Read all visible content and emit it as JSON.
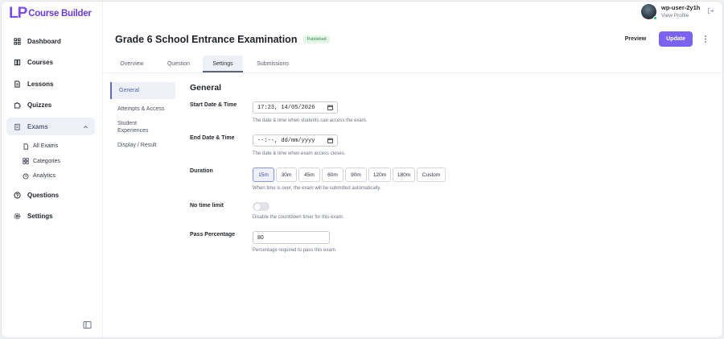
{
  "brand": {
    "mark": "LP",
    "name": "Course Builder"
  },
  "user": {
    "name": "wp-user-2y1h",
    "link": "View Profile"
  },
  "sidebar": {
    "items": [
      {
        "label": "Dashboard",
        "icon": "dashboard-icon"
      },
      {
        "label": "Courses",
        "icon": "book-icon"
      },
      {
        "label": "Lessons",
        "icon": "document-icon"
      },
      {
        "label": "Quizzes",
        "icon": "puzzle-icon"
      },
      {
        "label": "Exams",
        "icon": "clipboard-icon"
      },
      {
        "label": "Questions",
        "icon": "question-icon"
      },
      {
        "label": "Settings",
        "icon": "gear-icon"
      }
    ],
    "exams_sub": [
      {
        "label": "All Exams",
        "icon": "file-icon"
      },
      {
        "label": "Categories",
        "icon": "grid-icon"
      },
      {
        "label": "Analytics",
        "icon": "clock-icon"
      }
    ]
  },
  "header": {
    "title": "Grade 6 School Entrance Examination",
    "status": "Published",
    "preview_label": "Preview",
    "update_label": "Update"
  },
  "tabs": [
    "Overview",
    "Question",
    "Settings",
    "Submissions"
  ],
  "settings_menu": [
    "General",
    "Attempts & Access",
    "Student Experiences",
    "Display / Result"
  ],
  "form": {
    "section_title": "General",
    "start": {
      "label": "Start Date & Time",
      "value": "17:23, 14/05/2026",
      "help": "The date & time when students can access the exam."
    },
    "end": {
      "label": "End Date & Time",
      "value": "--:--, dd/mm/yyyy",
      "help": "The date & time when exam access closes."
    },
    "duration": {
      "label": "Duration",
      "options": [
        "15m",
        "30m",
        "45m",
        "60m",
        "90m",
        "120m",
        "180m",
        "Custom"
      ],
      "selected": "15m",
      "help": "When time is over, the exam will be submitted automatically."
    },
    "no_time_limit": {
      "label": "No time limit",
      "enabled": false,
      "help": "Disable the countdown timer for this exam."
    },
    "pass": {
      "label": "Pass Percentage",
      "value": "80",
      "help": "Percentage required to pass this exam."
    }
  },
  "colors": {
    "accent": "#7b63f0",
    "brand": "#7b4cf0",
    "badge_bg": "#e3f6e8",
    "badge_text": "#2f8a4a"
  }
}
